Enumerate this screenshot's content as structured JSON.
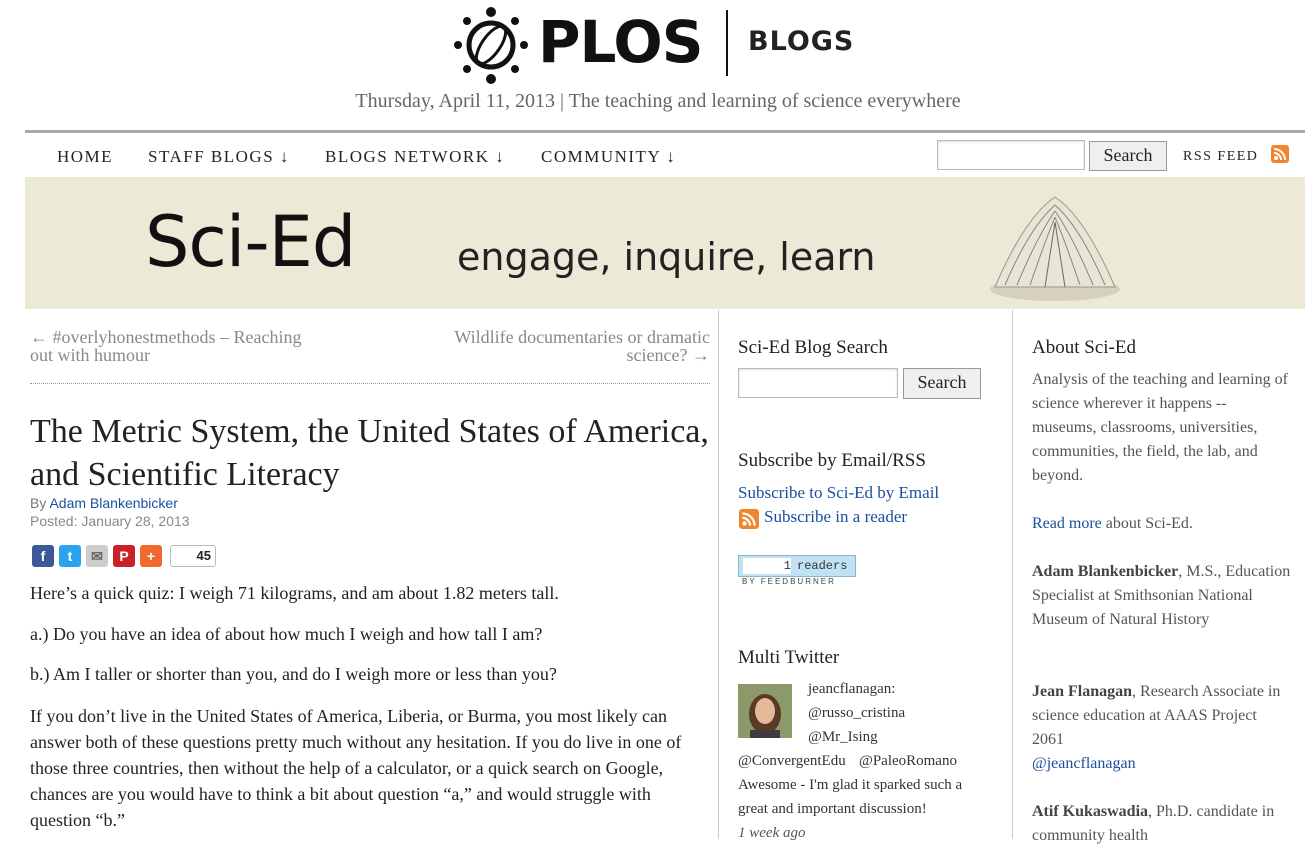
{
  "header": {
    "logo_text": "PLOS",
    "logo_sub": "BLOGS",
    "tagline": "Thursday, April 11, 2013 | The teaching and learning of science everywhere"
  },
  "nav": {
    "items": [
      "HOME",
      "STAFF BLOGS ↓",
      "BLOGS NETWORK ↓",
      "COMMUNITY ↓"
    ],
    "search_button": "Search",
    "rss_label": "RSS FEED"
  },
  "banner": {
    "title": "Sci-Ed",
    "subtitle": "engage, inquire, learn"
  },
  "post_nav": {
    "prev_line1": "← #overlyhonestmethods – Reaching",
    "prev_line2": "out with humour",
    "next_line1": "Wildlife documentaries or dramatic",
    "next_line2": "science? →"
  },
  "article": {
    "title": "The Metric System, the United States of America, and Scientific Literacy",
    "by_label": "By",
    "author": "Adam Blankenbicker",
    "posted": "Posted: January 28, 2013",
    "share_count": "45",
    "paragraphs": [
      "Here’s a quick quiz: I weigh 71 kilograms, and am about 1.82 meters tall.",
      "a.) Do you have an idea of about how much I weigh and how tall I am?",
      "b.) Am I taller or shorter than you, and do I weigh more or less than you?",
      "If you don’t live in the United States of America, Liberia, or Burma, you most likely can answer both of these questions pretty much without any hesitation. If you do live in one of those three countries, then without the help of a calculator, or a quick search on Google, chances are you would have to think a bit about question “a,” and would struggle with question “b.”"
    ]
  },
  "sidebar_middle": {
    "search_title": "Sci-Ed Blog Search",
    "search_button": "Search",
    "subscribe_title": "Subscribe by Email/RSS",
    "subscribe_email": "Subscribe to Sci-Ed by Email",
    "subscribe_reader": "Subscribe in a reader",
    "feed_readers_count": "1",
    "feed_readers_label": "readers",
    "feed_by": "BY FEEDBURNER",
    "twitter_title": "Multi Twitter",
    "tweet": {
      "user": "jeancflanagan:",
      "mention1": "@russo_cristina",
      "mention2": "@Mr_Ising",
      "mention3": "@ConvergentEdu",
      "mention4": "@PaleoRomano",
      "text_line1": "Awesome - I'm glad it sparked such a",
      "text_line2": "great and important discussion!",
      "time": "1 week ago"
    }
  },
  "sidebar_right": {
    "about_title": "About Sci-Ed",
    "about_text": "Analysis of the teaching and learning of science wherever it happens -- museums, classrooms, universities, communities, the field, the lab, and beyond.",
    "read_more": "Read more",
    "read_more_suffix": " about Sci-Ed.",
    "person1_name": "Adam Blankenbicker",
    "person1_desc": ", M.S., Education Specialist at Smithsonian National Museum of Natural History",
    "person2_name": "Jean Flanagan",
    "person2_desc": ", Research Associate in science education at AAAS Project 2061",
    "person2_handle": "@jeancflanagan",
    "person3_name": "Atif Kukaswadia",
    "person3_desc": ", Ph.D. candidate in community health"
  },
  "colors": {
    "link": "#1a4fa0",
    "banner_bg": "#ece9d6",
    "rss_orange": "#f0852d"
  }
}
